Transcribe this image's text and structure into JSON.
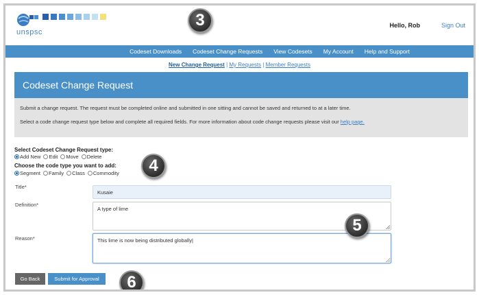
{
  "header": {
    "logo_text": "unspsc",
    "logo_colors": [
      "#2a5fa8",
      "#3a78c0",
      "#4a8fd0",
      "#6aa7dc",
      "#8bbde6",
      "#a9d0ee",
      "#c4e0f3",
      "#f2e27a"
    ],
    "greeting": "Hello, Rob",
    "sign_out": "Sign Out"
  },
  "nav": {
    "items": [
      "Codeset Downloads",
      "Codeset Change Requests",
      "View Codesets",
      "My Account",
      "Help and Support"
    ]
  },
  "subnav": {
    "items": [
      "New Change Request",
      "My Requests",
      "Member Requests"
    ],
    "separator": "|"
  },
  "page": {
    "title": "Codeset Change Request",
    "info_line1": "Submit a change request. The request must be completed online and submitted in one sitting and cannot be saved and returned to at a later time.",
    "info_line2_prefix": "Select a code change request type below and complete all required fields. For more information about code change requests please visit our ",
    "info_link": "help page."
  },
  "form": {
    "request_type_label": "Select Codeset Change Request type:",
    "request_types": [
      {
        "label": "Add New",
        "selected": true
      },
      {
        "label": "Edit",
        "selected": false
      },
      {
        "label": "Move",
        "selected": false
      },
      {
        "label": "Delete",
        "selected": false
      }
    ],
    "code_type_label": "Choose the code type you want to add:",
    "code_types": [
      {
        "label": "Segment",
        "selected": true
      },
      {
        "label": "Family",
        "selected": false
      },
      {
        "label": "Class",
        "selected": false
      },
      {
        "label": "Commodity",
        "selected": false
      }
    ],
    "title_label": "Title*",
    "title_value": "Kusaie",
    "definition_label": "Definition*",
    "definition_value": "A type of lime",
    "reason_label": "Reason*",
    "reason_value": "This lime is now being distributed globally|"
  },
  "buttons": {
    "back": "Go Back",
    "submit": "Submit for Approval"
  },
  "callouts": [
    "3",
    "4",
    "5",
    "6"
  ],
  "colors": {
    "accent": "#4a90c8",
    "info_bg": "#e3e3e3",
    "link": "#3b7fc4"
  }
}
